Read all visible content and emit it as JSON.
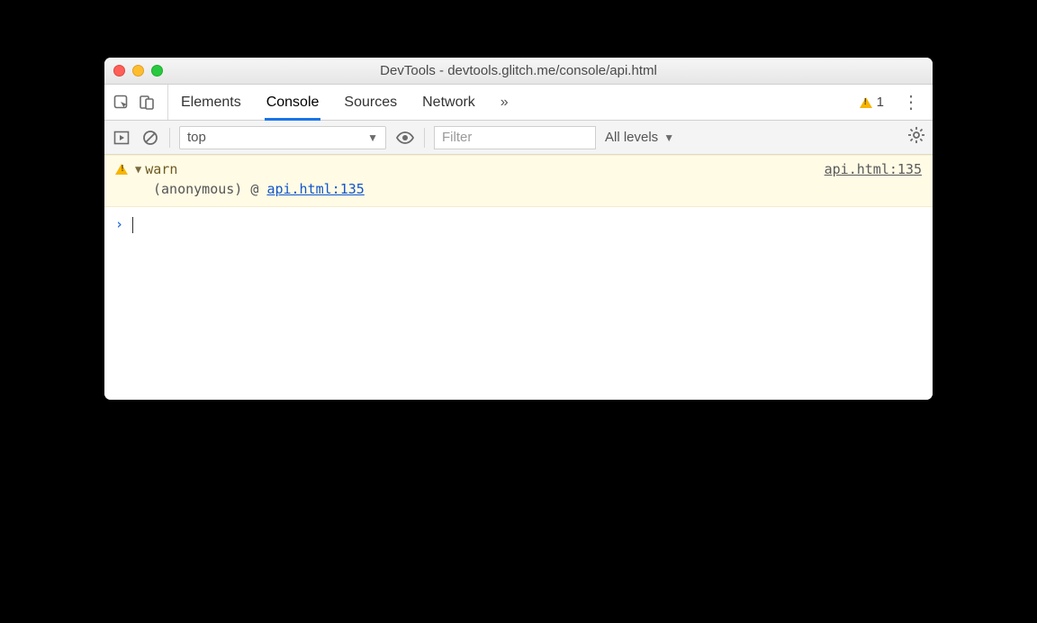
{
  "window": {
    "title": "DevTools - devtools.glitch.me/console/api.html"
  },
  "tabs": {
    "items": [
      "Elements",
      "Console",
      "Sources",
      "Network"
    ],
    "active_index": 1,
    "overflow_glyph": "»"
  },
  "tabstrip": {
    "warning_count": "1"
  },
  "filterbar": {
    "context": "top",
    "filter_placeholder": "Filter",
    "levels_label": "All levels"
  },
  "console": {
    "warn": {
      "label": "warn",
      "source": "api.html:135",
      "stack_prefix": "(anonymous) @ ",
      "stack_link": "api.html:135"
    },
    "prompt_glyph": "›"
  }
}
